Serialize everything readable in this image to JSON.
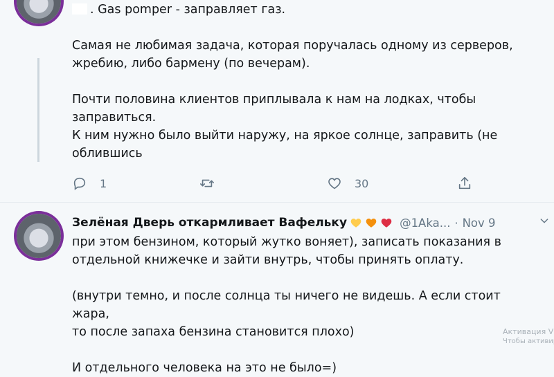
{
  "tweet1": {
    "lines": [
      ". Gas pomper - заправляет газ.",
      "",
      "Самая не любимая задача, которая поручалась одному из серверов,",
      "жребию, либо бармену (по вечерам).",
      "",
      "Почти половина клиентов приплывала к нам на лодках, чтобы",
      "заправиться.",
      "К ним нужно было выйти наружу, на яркое солнце, заправить (не",
      "облившись"
    ],
    "reply_count": "1",
    "like_count": "30"
  },
  "tweet2": {
    "author": "Зелёная Дверь откармливает Вафельку",
    "handle": "@1Aka...",
    "dot": "·",
    "date": "Nov 9",
    "lines": [
      "при этом бензином, который жутко воняет), записать показания в",
      "отдельной книжечке и зайти внутрь, чтобы принять оплату.",
      "",
      "(внутри темно, и после солнца ты ничего не видешь. А если стоит жара,",
      "то после запаха бензина становится плохо)",
      "",
      "И отдельного человека на это не было=)"
    ]
  },
  "watermark": {
    "line1": "Активация V",
    "line2": "Чтобы активиро"
  },
  "icons": {
    "reply": "reply-icon",
    "retweet": "retweet-icon",
    "like": "heart-icon",
    "share": "share-icon",
    "caret": "chevron-down-icon",
    "emoji": [
      "yellow-heart-icon",
      "orange-heart-icon",
      "red-heart-icon"
    ]
  },
  "colors": {
    "background": "#f5f8fa",
    "text": "#14171a",
    "secondary": "#657786",
    "avatar_ring": "#7b2f9a"
  }
}
